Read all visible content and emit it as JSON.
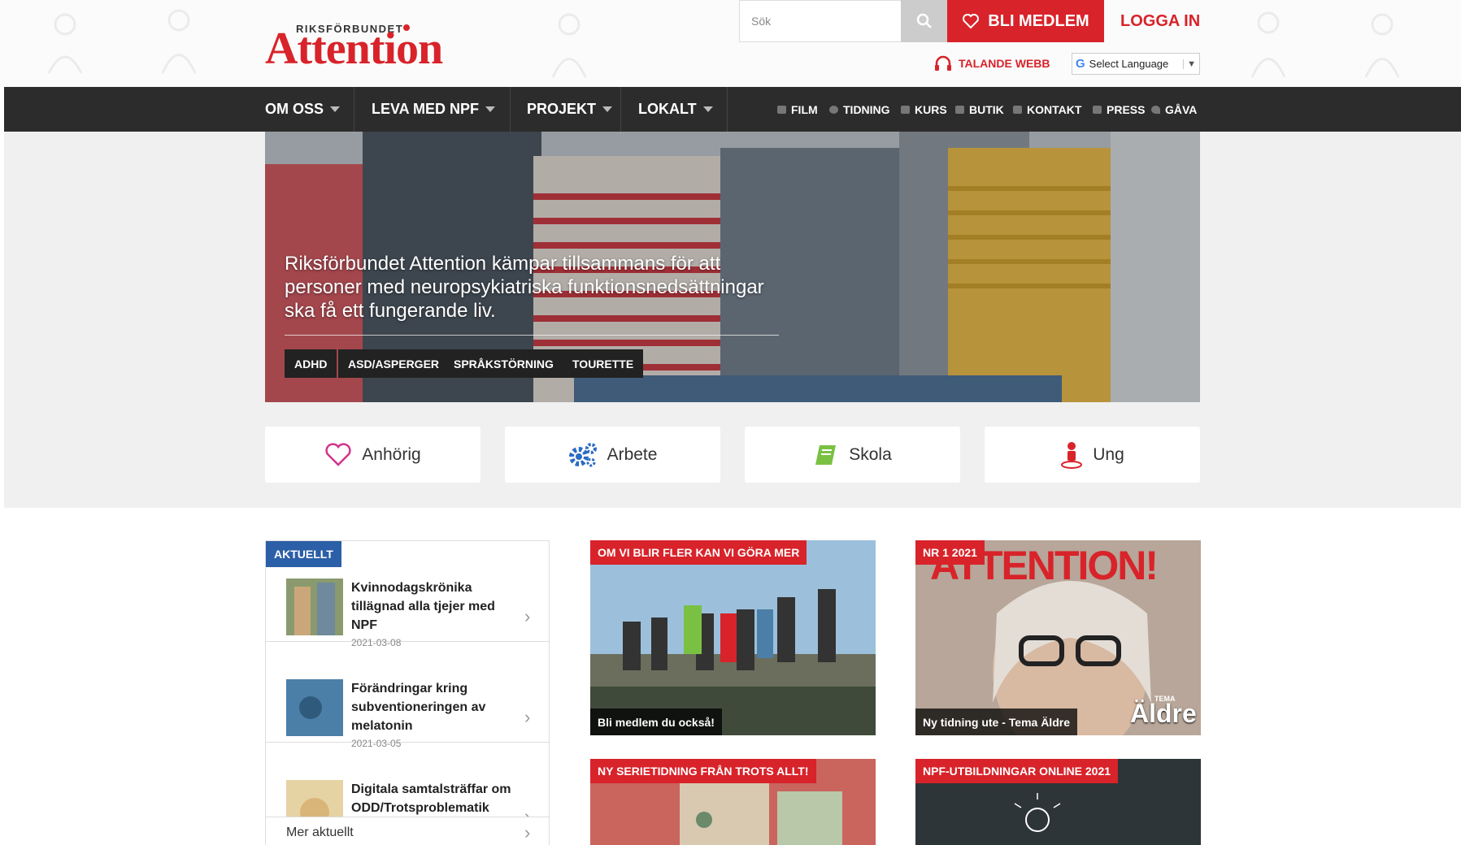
{
  "header": {
    "logo_small": "RIKSFÖRBUNDET",
    "logo_big": "Attention",
    "search_placeholder": "Sök",
    "member_label": "BLI MEDLEM",
    "login_label": "LOGGA IN",
    "talande_label": "TALANDE WEBB",
    "language_label": "Select Language",
    "brand_color": "#d8232a"
  },
  "nav": {
    "main": [
      "OM OSS",
      "LEVA MED NPF",
      "PROJEKT",
      "LOKALT"
    ],
    "secondary": [
      "FILM",
      "TIDNING",
      "KURS",
      "BUTIK",
      "KONTAKT",
      "PRESS",
      "GÅVA"
    ]
  },
  "hero": {
    "text": "Riksförbundet Attention kämpar tillsammans för att personer med neuropsykiatriska funktionsnedsättningar ska få ett fungerande liv.",
    "tags": [
      "ADHD",
      "ASD/ASPERGER",
      "SPRÅKSTÖRNING",
      "TOURETTE"
    ]
  },
  "tiles": [
    {
      "label": "Anhörig",
      "icon": "heart-icon"
    },
    {
      "label": "Arbete",
      "icon": "gears-icon"
    },
    {
      "label": "Skola",
      "icon": "book-icon"
    },
    {
      "label": "Ung",
      "icon": "person-pin-icon"
    }
  ],
  "news": {
    "header": "AKTUELLT",
    "items": [
      {
        "title": "Kvinnodagskrönika tillägnad alla tjejer med NPF",
        "date": "2021-03-08"
      },
      {
        "title": "Förändringar kring subventioneringen av melatonin",
        "date": "2021-03-05"
      },
      {
        "title": "Digitala samtalsträffar om ODD/Trotsproblematik",
        "date": ""
      }
    ],
    "more": "Mer aktuellt"
  },
  "cards": [
    {
      "label": "OM VI BLIR FLER KAN VI GÖRA MER",
      "caption": "Bli medlem du också!"
    },
    {
      "label": "NR 1 2021",
      "caption": "Ny tidning ute - Tema Äldre",
      "cover_title": "ATTENTION!",
      "cover_theme": "Äldre",
      "cover_theme_prefix": "TEMA"
    },
    {
      "label": "NY SERIETIDNING FRÅN TROTS ALLT!",
      "caption": ""
    },
    {
      "label": "NPF-UTBILDNINGAR ONLINE 2021",
      "caption": ""
    }
  ]
}
